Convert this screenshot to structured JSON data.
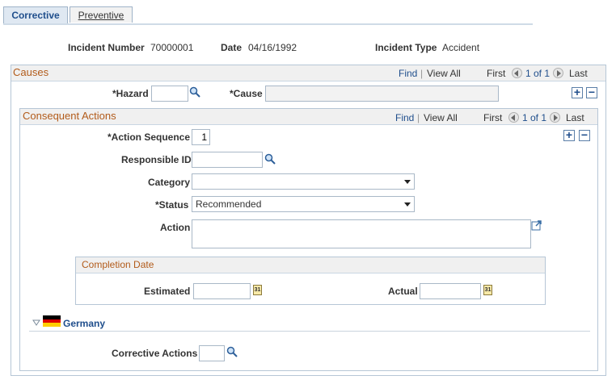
{
  "tabs": [
    {
      "label": "Corrective",
      "active": true
    },
    {
      "label": "Preventive",
      "active": false
    }
  ],
  "incident": {
    "number_label": "Incident Number",
    "number_value": "70000001",
    "date_label": "Date",
    "date_value": "04/16/1992",
    "type_label": "Incident Type",
    "type_value": "Accident"
  },
  "causes": {
    "title": "Causes",
    "find": "Find",
    "sep": "|",
    "view_all": "View All",
    "first": "First",
    "count": "1 of 1",
    "last": "Last",
    "hazard_label": "*Hazard",
    "hazard_value": "",
    "cause_label": "*Cause",
    "cause_value": ""
  },
  "consequent": {
    "title": "Consequent Actions",
    "find": "Find",
    "sep": "|",
    "view_all": "View All",
    "first": "First",
    "count": "1 of 1",
    "last": "Last",
    "action_seq_label": "*Action Sequence",
    "action_seq_value": "1",
    "responsible_label": "Responsible ID",
    "responsible_value": "",
    "category_label": "Category",
    "category_value": "",
    "status_label": "*Status",
    "status_value": "Recommended",
    "action_label": "Action",
    "action_value": ""
  },
  "completion": {
    "title": "Completion Date",
    "estimated_label": "Estimated",
    "estimated_value": "",
    "actual_label": "Actual",
    "actual_value": "",
    "calendar_text": "31"
  },
  "germany": {
    "title": "Germany",
    "corrective_actions_label": "Corrective Actions",
    "corrective_actions_value": ""
  },
  "icons": {
    "lookup": "magnifier-icon",
    "calendar": "calendar-icon",
    "expand": "expand-editor-icon",
    "flag": "germany-flag-icon",
    "collapse": "collapse-triangle-icon"
  },
  "colors": {
    "section_title": "#b25b1a",
    "link": "#1f4e8c",
    "tab_active_bg": "#dfe8f2",
    "header_bg": "#f0f0f0"
  }
}
